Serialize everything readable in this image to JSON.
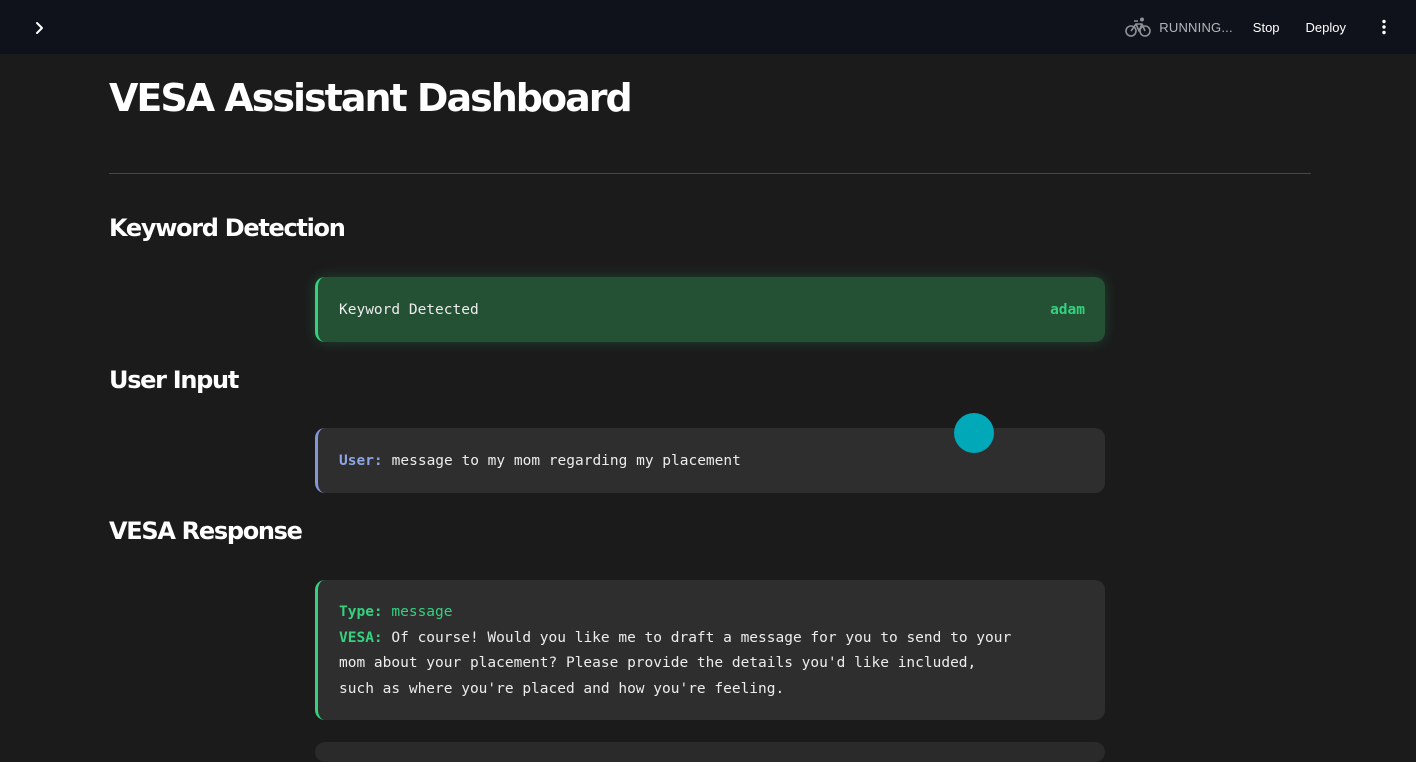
{
  "topbar": {
    "running_text": "RUNNING...",
    "stop_label": "Stop",
    "deploy_label": "Deploy"
  },
  "page": {
    "title": "VESA Assistant Dashboard"
  },
  "keyword_section": {
    "title": "Keyword Detection",
    "label": "Keyword Detected",
    "value": "adam"
  },
  "user_section": {
    "title": "User Input",
    "label": "User:",
    "message": "message to my mom regarding my placement"
  },
  "response_section": {
    "title": "VESA Response",
    "type_label": "Type:",
    "type_value": "message",
    "vesa_label": "VESA:",
    "line1": "Of course! Would you like me to draft a message for you to send to your",
    "line2": "mom about your placement? Please provide the details you'd like included,",
    "line3": "such as where you're placed and how you're feeling."
  },
  "icons": {
    "expand": "chevron-right-icon",
    "running": "bicycle-icon",
    "menu": "vertical-dots-icon"
  },
  "colors": {
    "accent_green": "#34d17f",
    "user_blue": "#8ea4e6",
    "cursor": "#00a8b8"
  }
}
